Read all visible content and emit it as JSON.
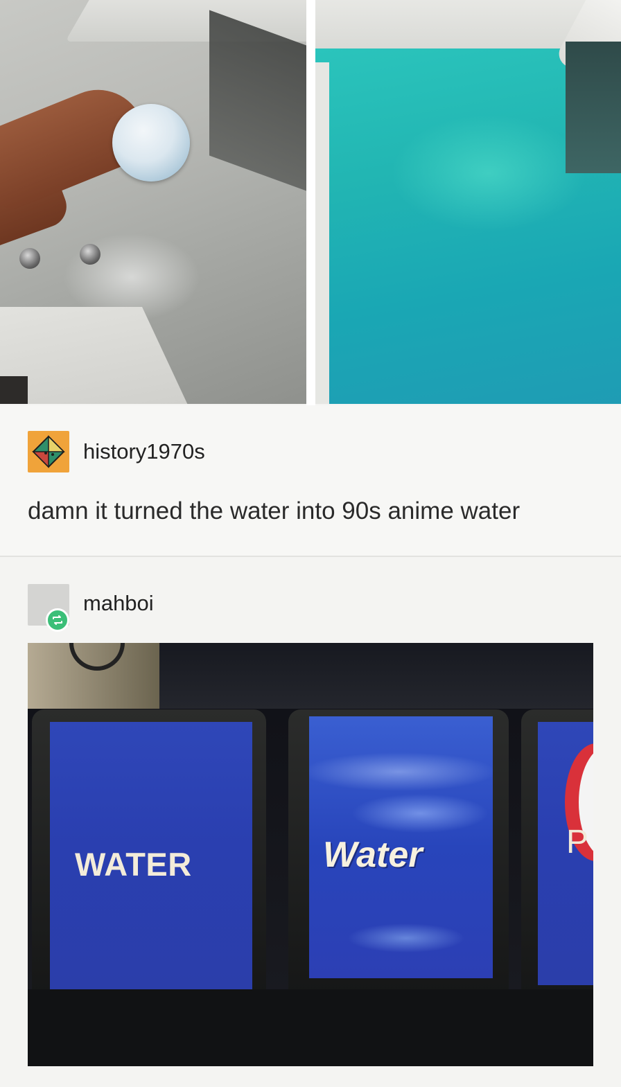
{
  "top_images": {
    "left": {
      "scene": "hand holding bath bomb over clear water tub"
    },
    "right": {
      "scene": "tub filled with turquoise water"
    }
  },
  "post1": {
    "username": "history1970s",
    "text": "damn it turned the water into 90s anime water",
    "avatar_color": "#f0a33a"
  },
  "post2": {
    "username": "mahboi",
    "reblog_color": "#3bbf78"
  },
  "machine": {
    "button1_label": "WATER",
    "button2_label": "Water",
    "button3_partial_label": "P"
  }
}
